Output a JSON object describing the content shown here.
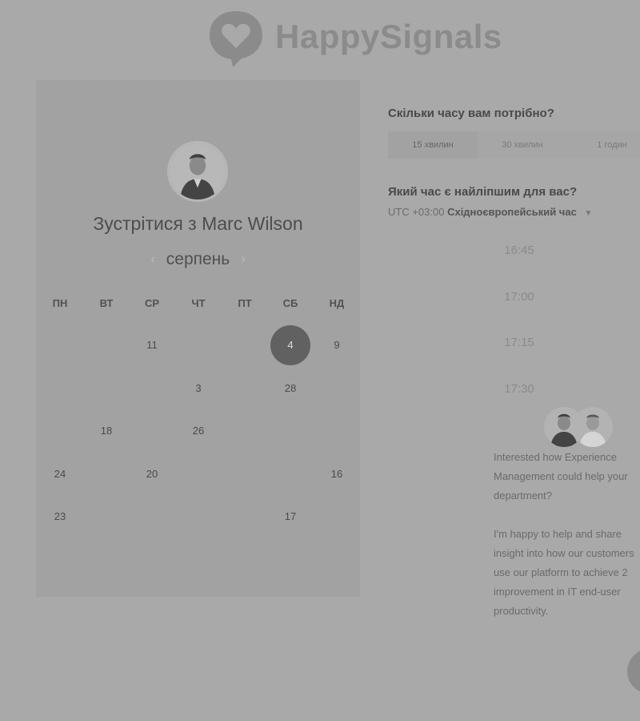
{
  "brand": {
    "name": "HappySignals"
  },
  "host": {
    "meet_title": "Зустрітися з Marc Wilson"
  },
  "calendar": {
    "month": "серпень",
    "weekdays": [
      "ПН",
      "ВТ",
      "СР",
      "ЧТ",
      "ПТ",
      "СБ",
      "НД"
    ],
    "selected_day": "4",
    "days": [
      {
        "label": "",
        "muted": true,
        "row": 0,
        "col": 0
      },
      {
        "label": "",
        "muted": true,
        "row": 0,
        "col": 1
      },
      {
        "label": "11",
        "muted": false,
        "row": 0,
        "col": 2
      },
      {
        "label": "4",
        "muted": false,
        "row": 0,
        "col": 5,
        "selected": true
      },
      {
        "label": "9",
        "muted": false,
        "row": 0,
        "col": 6
      },
      {
        "label": "3",
        "muted": false,
        "row": 1,
        "col": 3
      },
      {
        "label": "28",
        "muted": false,
        "row": 1,
        "col": 5
      },
      {
        "label": "18",
        "muted": false,
        "row": 2,
        "col": 1
      },
      {
        "label": "26",
        "muted": false,
        "row": 2,
        "col": 3
      },
      {
        "label": "24",
        "muted": false,
        "row": 3,
        "col": 0
      },
      {
        "label": "20",
        "muted": false,
        "row": 3,
        "col": 2
      },
      {
        "label": "16",
        "muted": false,
        "row": 3,
        "col": 6
      },
      {
        "label": "23",
        "muted": false,
        "row": 4,
        "col": 0
      },
      {
        "label": "17",
        "muted": false,
        "row": 4,
        "col": 5
      }
    ]
  },
  "duration": {
    "question": "Скільки часу вам потрібно?",
    "options": [
      "15 хвилин",
      "30 хвилин",
      "1 годин"
    ],
    "active_index": 0
  },
  "timezone": {
    "question": "Який час є найліпшим для вас?",
    "offset": "UTC +03:00",
    "name": "Східноєвропейський час"
  },
  "slots": [
    "16:45",
    "17:00",
    "17:15",
    "17:30"
  ],
  "chat": {
    "message_1": "Interested how Experience Management could help your department?",
    "message_2": "I'm happy to help and share insight into how our customers use our platform to achieve 2 improvement in IT end-user productivity."
  }
}
